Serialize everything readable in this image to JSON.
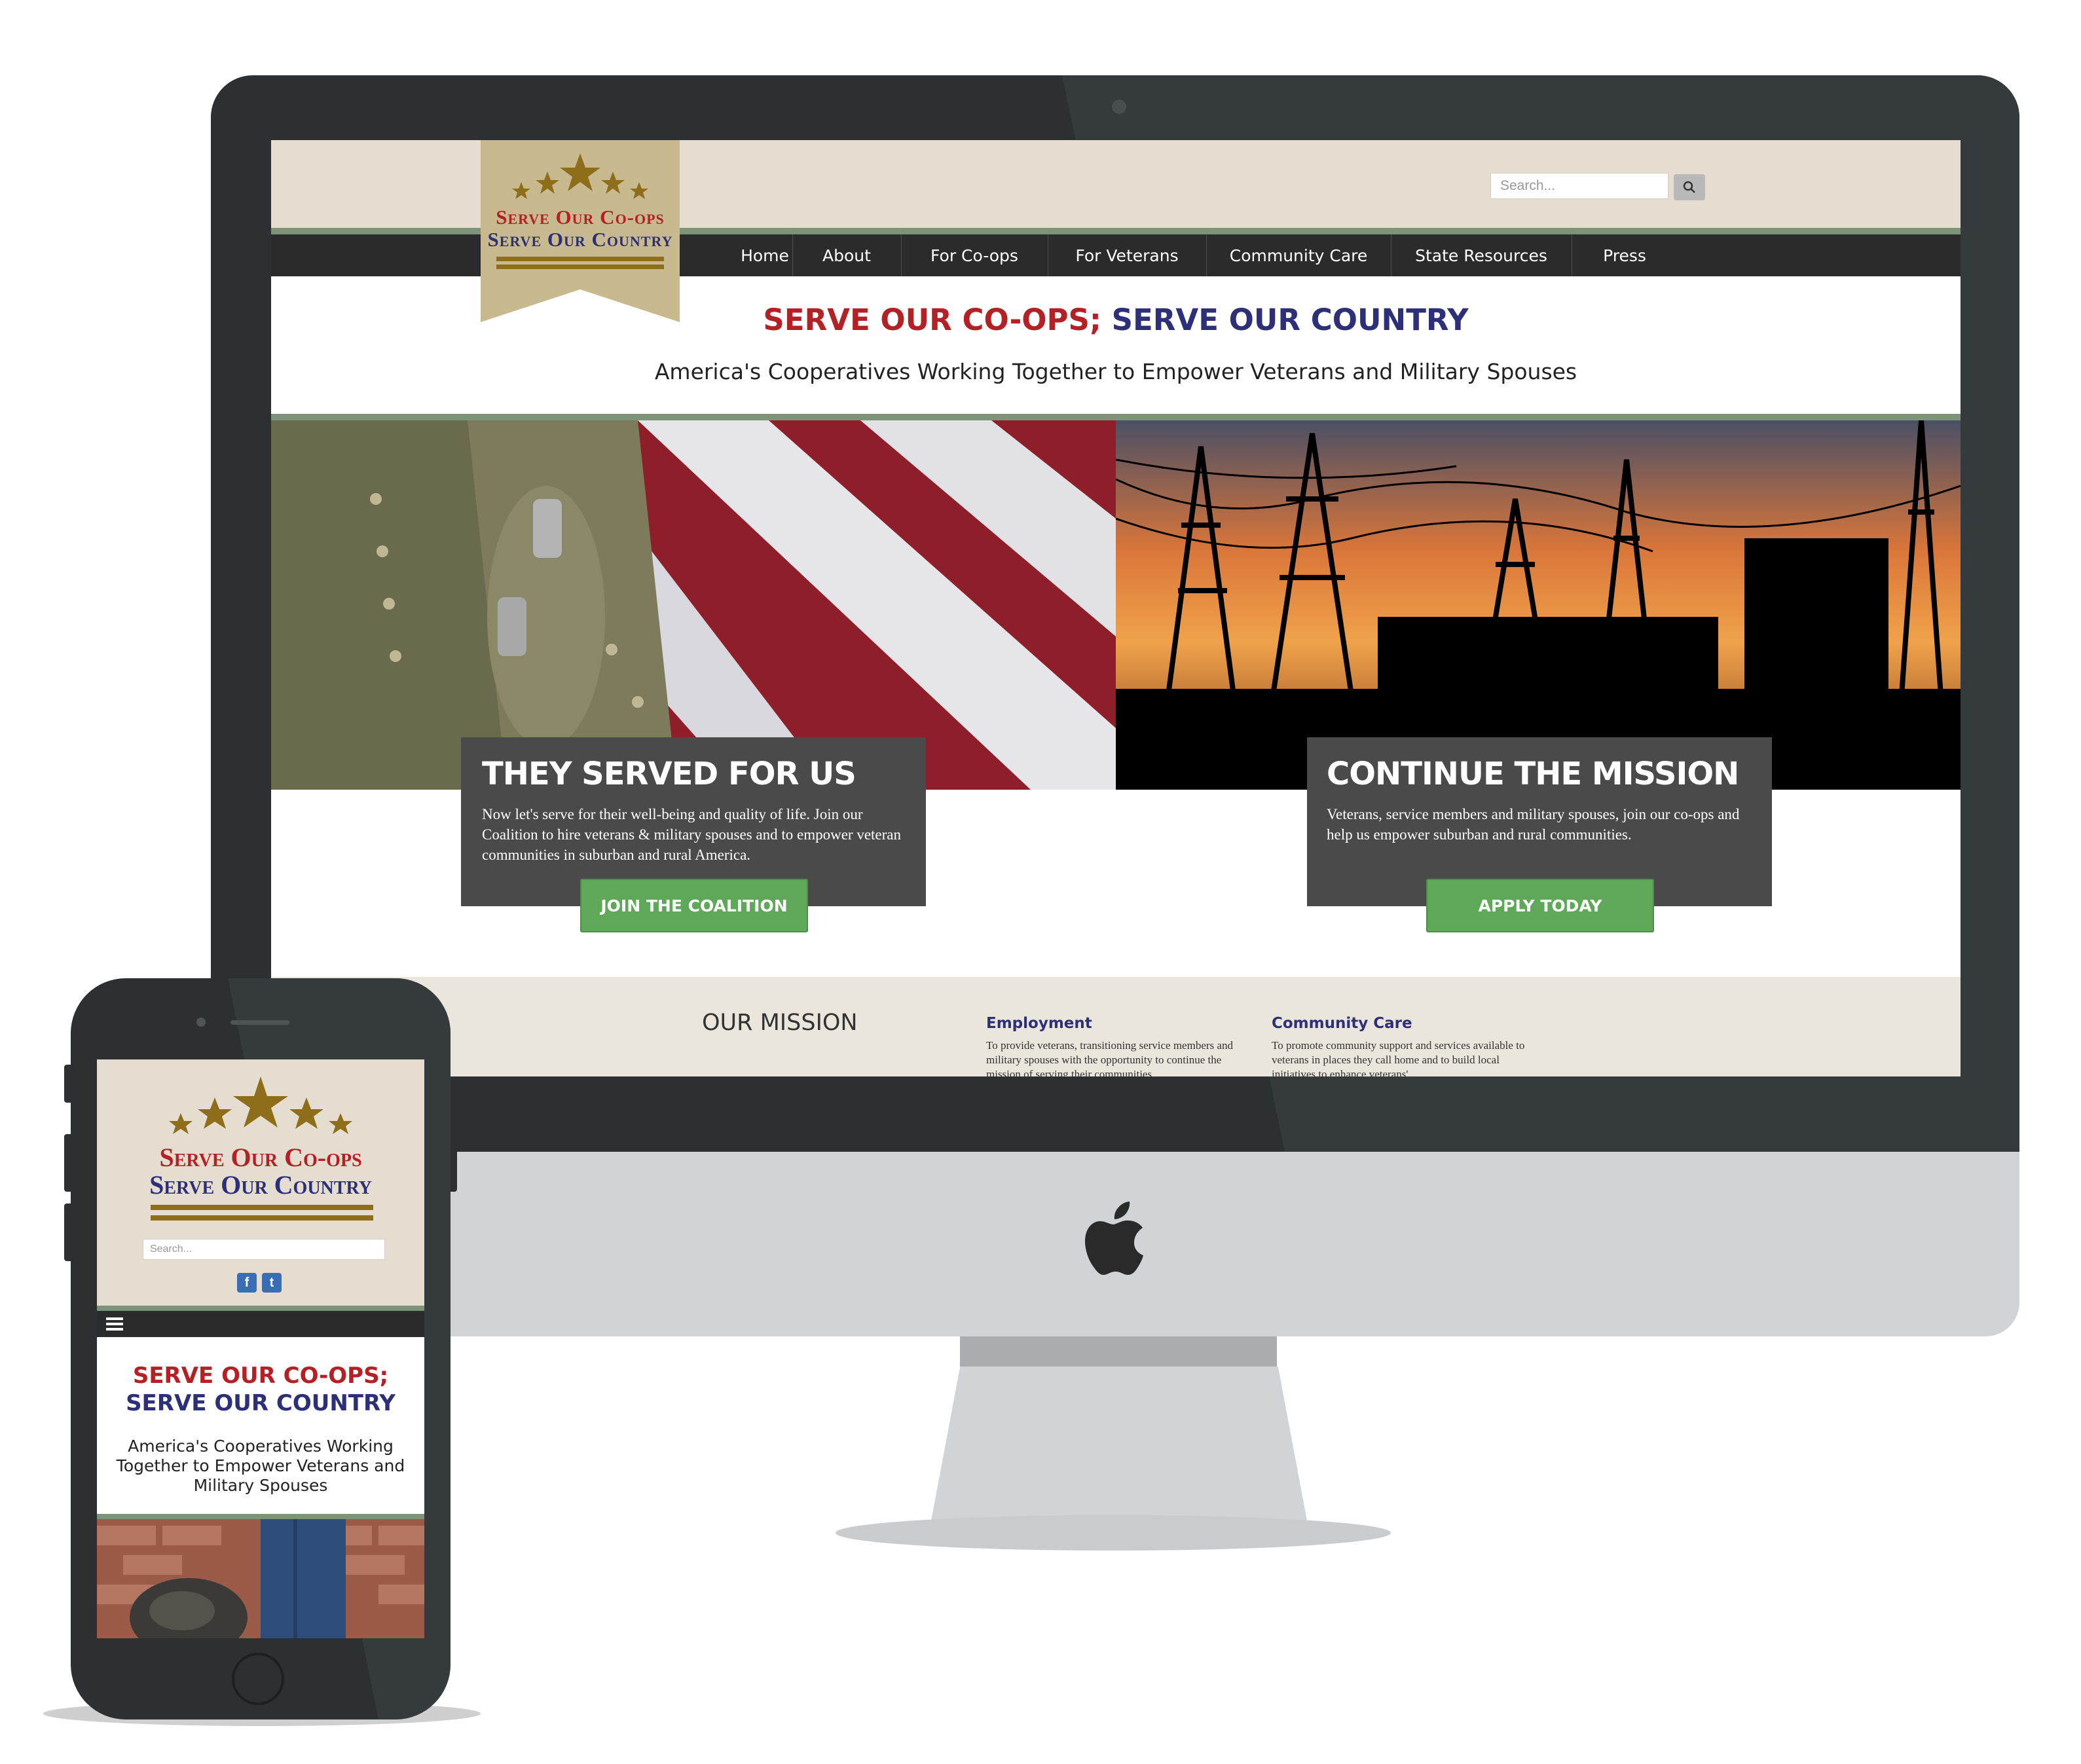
{
  "site": {
    "logo": {
      "line1": "Serve Our Co-ops",
      "line2": "Serve Our Country"
    },
    "search": {
      "placeholder": "Search..."
    },
    "nav": [
      "Home",
      "About",
      "For Co-ops",
      "For Veterans",
      "Community Care",
      "State Resources",
      "Press"
    ],
    "hero": {
      "title_red": "SERVE OUR CO-OPS;",
      "title_blue": "SERVE OUR COUNTRY",
      "subtitle": "America's Cooperatives Working Together to Empower Veterans and Military Spouses"
    },
    "panels": [
      {
        "title": "THEY SERVED FOR US",
        "text": "Now let's serve for their well-being and quality of life. Join our Coalition to hire veterans & military spouses and to empower veteran communities in suburban and rural America.",
        "button": "JOIN THE COALITION"
      },
      {
        "title": "CONTINUE THE MISSION",
        "text": "Veterans, service members and military spouses, join our co-ops and help us empower suburban and rural communities.",
        "button": "APPLY TODAY"
      }
    ],
    "mission": {
      "title": "OUR MISSION",
      "columns": [
        {
          "heading": "Employment",
          "text": "To provide veterans, transitioning service members and military spouses with the opportunity to continue the mission of serving their communities"
        },
        {
          "heading": "Community Care",
          "text": "To promote community support and services available to veterans in places they call home and to build local initiatives to enhance veterans'"
        }
      ]
    }
  },
  "mobile": {
    "logo": {
      "line1": "Serve Our Co-ops",
      "line2": "Serve Our Country"
    },
    "search": {
      "placeholder": "Search..."
    },
    "social": [
      "f",
      "t"
    ],
    "title_red": "SERVE OUR CO-OPS;",
    "title_blue": "SERVE OUR COUNTRY",
    "subtitle": "America's Cooperatives Working Together to Empower Veterans and Military Spouses"
  },
  "colors": {
    "brand_red": "#b42024",
    "brand_blue": "#2d2f78",
    "cta_green": "#5fa85a",
    "header_beige": "#e5ded0",
    "nav_dark": "#2b2b2b",
    "gold": "#8e6e1b"
  },
  "icons": [
    "star-icon",
    "search-icon",
    "facebook-icon",
    "twitter-icon",
    "hamburger-menu-icon",
    "apple-logo-icon"
  ]
}
